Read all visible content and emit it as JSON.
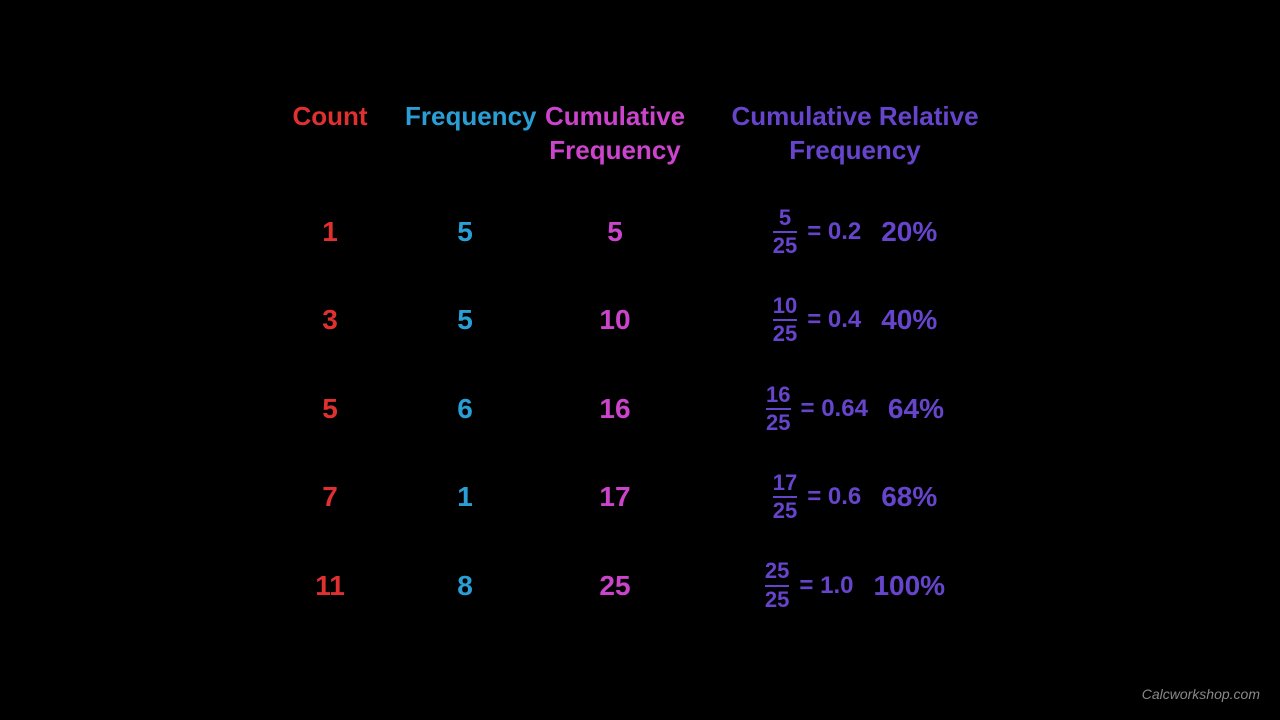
{
  "headers": {
    "count": "Count",
    "frequency": "Frequency",
    "cumfreq": "Cumulative Frequency",
    "cumrelfreq_line1": "Cumulative Relative",
    "cumrelfreq_line2": "Frequency"
  },
  "rows": [
    {
      "count": "1",
      "frequency": "5",
      "cumfreq": "5",
      "numerator": "5",
      "denominator": "25",
      "decimal": "= 0.2",
      "percent": "20%"
    },
    {
      "count": "3",
      "frequency": "5",
      "cumfreq": "10",
      "numerator": "10",
      "denominator": "25",
      "decimal": "= 0.4",
      "percent": "40%"
    },
    {
      "count": "5",
      "frequency": "6",
      "cumfreq": "16",
      "numerator": "16",
      "denominator": "25",
      "decimal": "= 0.64",
      "percent": "64%"
    },
    {
      "count": "7",
      "frequency": "1",
      "cumfreq": "17",
      "numerator": "17",
      "denominator": "25",
      "decimal": "= 0.6",
      "percent": "68%"
    },
    {
      "count": "11",
      "frequency": "8",
      "cumfreq": "25",
      "numerator": "25",
      "denominator": "25",
      "decimal": "= 1.0",
      "percent": "100%"
    }
  ],
  "watermark": "Calcworkshop.com"
}
